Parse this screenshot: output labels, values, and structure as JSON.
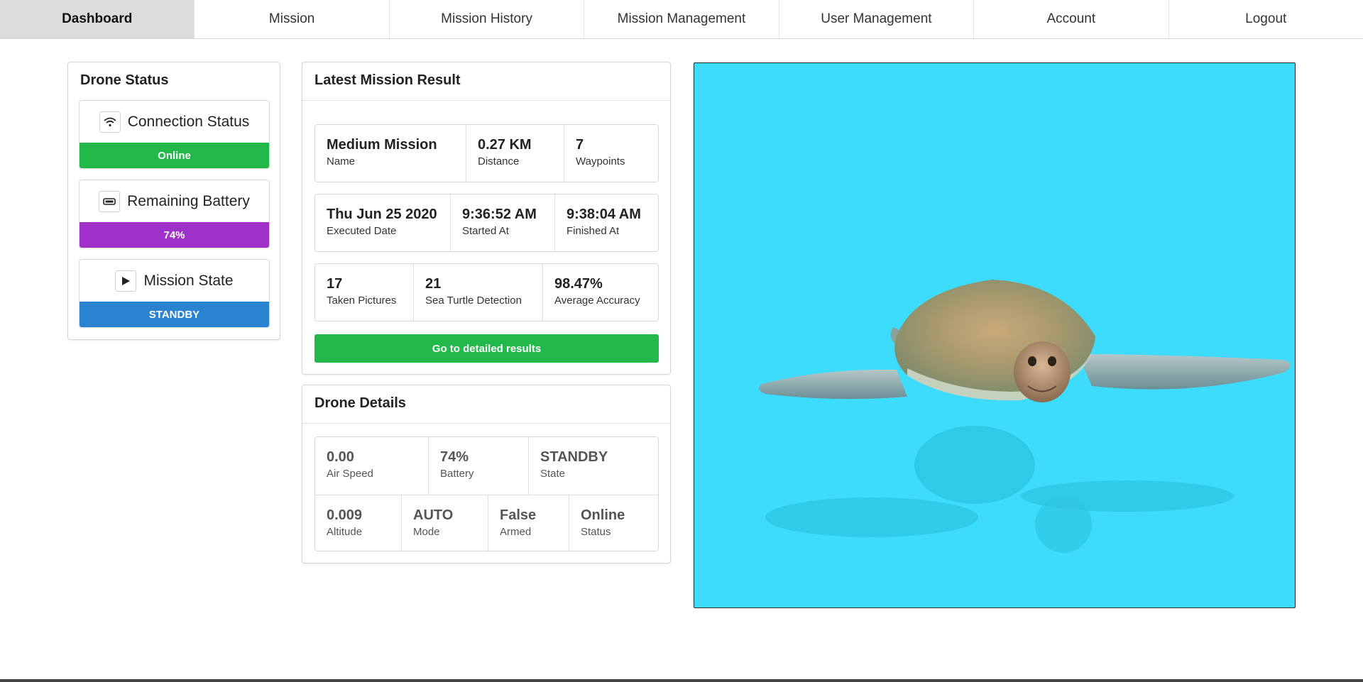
{
  "nav": {
    "items": [
      {
        "label": "Dashboard",
        "active": true
      },
      {
        "label": "Mission"
      },
      {
        "label": "Mission History"
      },
      {
        "label": "Mission Management"
      },
      {
        "label": "User Management"
      },
      {
        "label": "Account"
      },
      {
        "label": "Logout"
      }
    ]
  },
  "drone_status": {
    "title": "Drone Status",
    "connection": {
      "label": "Connection Status",
      "value": "Online",
      "icon": "wifi-icon",
      "color": "#22b84a"
    },
    "battery": {
      "label": "Remaining Battery",
      "value": "74%",
      "icon": "battery-icon",
      "color": "#a031c8"
    },
    "mission_state": {
      "label": "Mission State",
      "value": "STANDBY",
      "icon": "play-icon",
      "color": "#2a83d1"
    }
  },
  "latest_mission": {
    "title": "Latest Mission Result",
    "rows": [
      [
        {
          "value": "Medium Mission",
          "label": "Name"
        },
        {
          "value": "0.27 KM",
          "label": "Distance"
        },
        {
          "value": "7",
          "label": "Waypoints"
        }
      ],
      [
        {
          "value": "Thu Jun 25 2020",
          "label": "Executed Date"
        },
        {
          "value": "9:36:52 AM",
          "label": "Started At"
        },
        {
          "value": "9:38:04 AM",
          "label": "Finished At"
        }
      ],
      [
        {
          "value": "17",
          "label": "Taken Pictures"
        },
        {
          "value": "21",
          "label": "Sea Turtle Detection"
        },
        {
          "value": "98.47%",
          "label": "Average Accuracy"
        }
      ]
    ],
    "button_label": "Go to detailed results"
  },
  "drone_details": {
    "title": "Drone Details",
    "rows": [
      [
        {
          "value": "0.00",
          "label": "Air Speed"
        },
        {
          "value": "74%",
          "label": "Battery"
        },
        {
          "value": "STANDBY",
          "label": "State"
        }
      ],
      [
        {
          "value": "0.009",
          "label": "Altitude"
        },
        {
          "value": "AUTO",
          "label": "Mode"
        },
        {
          "value": "False",
          "label": "Armed"
        },
        {
          "value": "Online",
          "label": "Status"
        }
      ]
    ]
  },
  "image": {
    "subject": "sea turtle",
    "background": "#3ddcfd"
  }
}
